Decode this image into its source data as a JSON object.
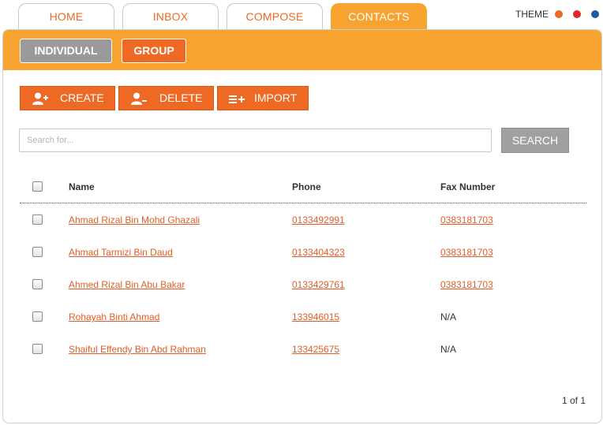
{
  "nav": {
    "tabs": [
      {
        "label": "HOME"
      },
      {
        "label": "INBOX"
      },
      {
        "label": "COMPOSE"
      },
      {
        "label": "CONTACTS",
        "active": true
      }
    ]
  },
  "theme": {
    "label": "THEME",
    "colors": [
      "#ee6a24",
      "#e0262e",
      "#1f5aa6"
    ]
  },
  "subtabs": {
    "individual": "INDIVIDUAL",
    "group": "GROUP"
  },
  "actions": {
    "create": "CREATE",
    "delete": "DELETE",
    "import": "IMPORT"
  },
  "search": {
    "placeholder": "Search for...",
    "button": "SEARCH"
  },
  "table": {
    "columns": {
      "name": "Name",
      "phone": "Phone",
      "fax": "Fax Number"
    },
    "rows": [
      {
        "name": "Ahmad Rizal Bin Mohd Ghazali",
        "phone": "0133492991",
        "fax": "0383181703"
      },
      {
        "name": "Ahmad Tarmizi Bin Daud",
        "phone": "0133404323",
        "fax": "0383181703"
      },
      {
        "name": "Ahmed Rizal Bin Abu Bakar",
        "phone": "0133429761",
        "fax": "0383181703"
      },
      {
        "name": "Rohayah Binti Ahmad",
        "phone": "133946015",
        "fax": "N/A"
      },
      {
        "name": "Shaiful Effendy Bin Abd Rahman",
        "phone": "133425675",
        "fax": "N/A"
      }
    ]
  },
  "pager": "1 of 1",
  "colors": {
    "accent": "#f7a32f",
    "button": "#ee6a24",
    "link": "#e35d28",
    "subtab_active_bg": "#9a9a9a"
  }
}
